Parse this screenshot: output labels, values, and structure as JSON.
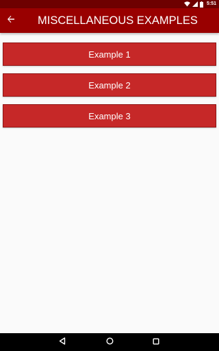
{
  "status_bar": {
    "time": "5:51",
    "icons": [
      "wifi-icon",
      "signal-icon",
      "battery-icon"
    ]
  },
  "app_bar": {
    "title": "MISCELLANEOUS EXAMPLES",
    "back_icon": "arrow-left-icon"
  },
  "examples": [
    {
      "label": "Example 1"
    },
    {
      "label": "Example 2"
    },
    {
      "label": "Example 3"
    }
  ],
  "nav_bar": {
    "buttons": [
      "back-triangle-icon",
      "home-circle-icon",
      "recents-square-icon"
    ]
  },
  "colors": {
    "status_bar": "#6e0000",
    "app_bar": "#990000",
    "button": "#c62828",
    "background": "#fafafa"
  }
}
